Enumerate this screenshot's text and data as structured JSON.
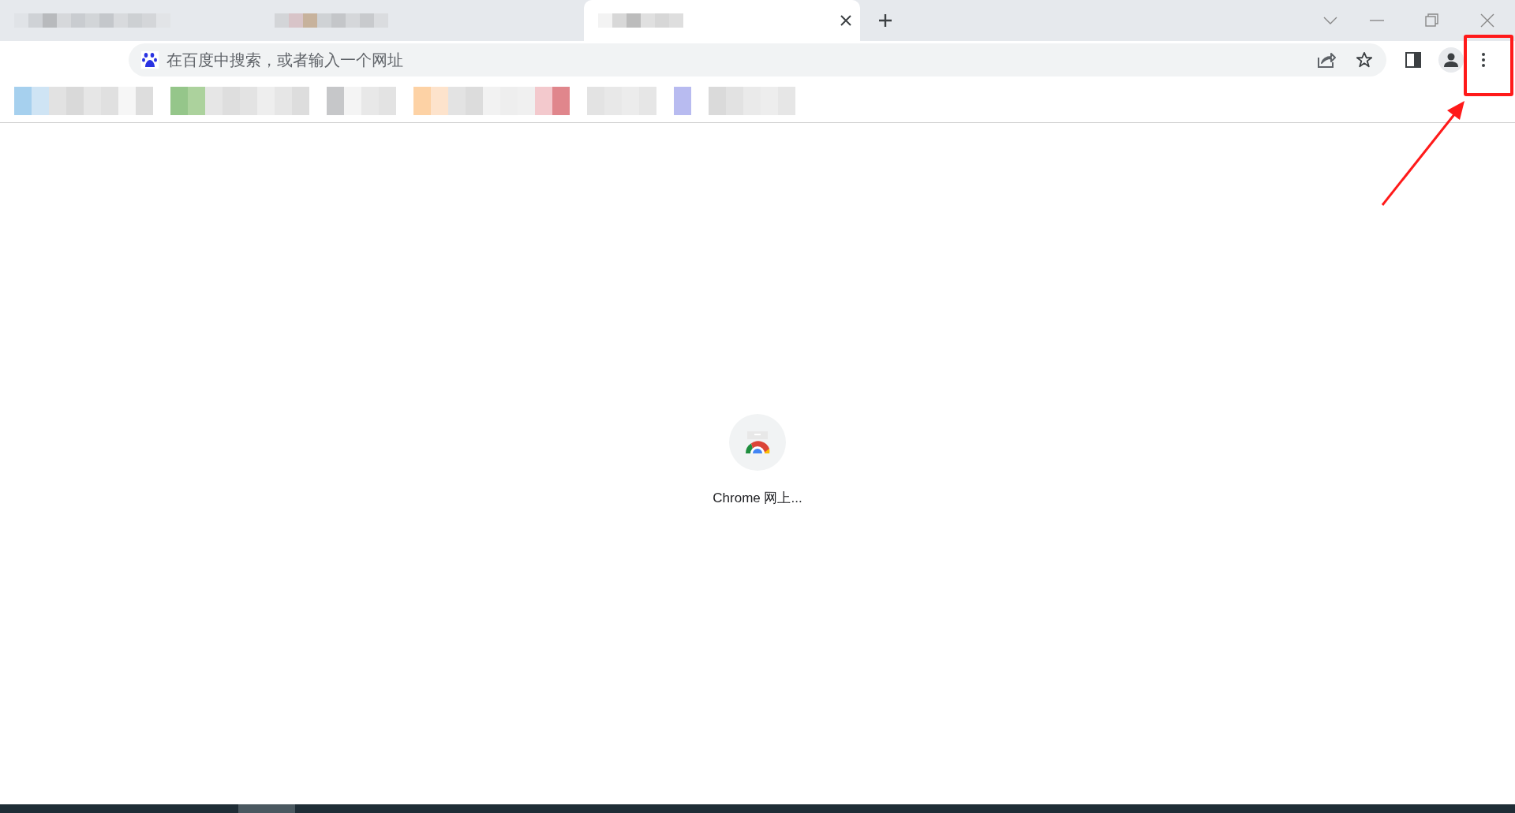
{
  "address_bar": {
    "placeholder": "在百度中搜索，或者输入一个网址"
  },
  "shortcuts": [
    {
      "label": "Chrome 网上..."
    }
  ]
}
